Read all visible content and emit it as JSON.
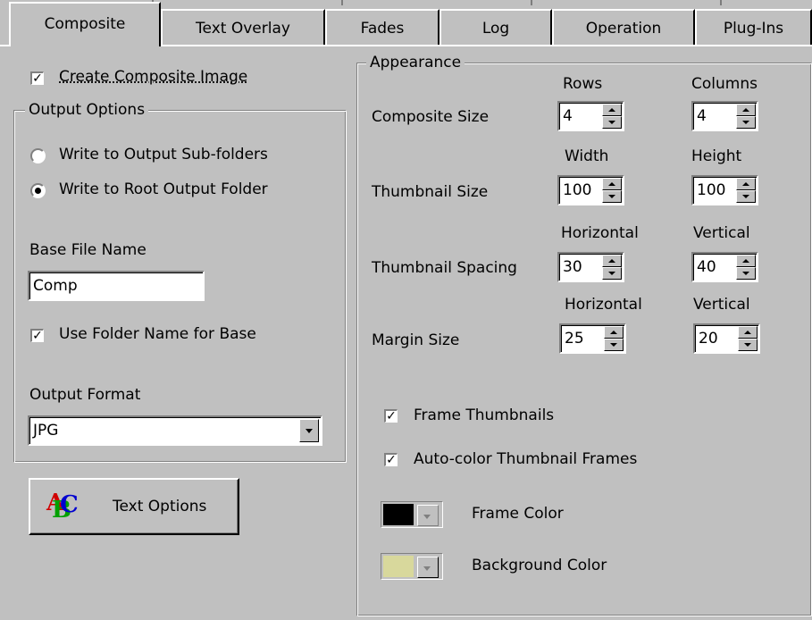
{
  "tabs": [
    "Composite",
    "Text Overlay",
    "Fades",
    "Log",
    "Operation",
    "Plug-Ins"
  ],
  "left": {
    "create_composite": {
      "label": "Create Composite Image",
      "checked": true
    },
    "output_options": {
      "title": "Output Options",
      "radio_subfolders": {
        "label": "Write to Output Sub-folders",
        "selected": false
      },
      "radio_root": {
        "label": "Write to Root Output Folder",
        "selected": true
      },
      "base_file_name": {
        "label": "Base File Name",
        "value": "Comp"
      },
      "use_folder_name": {
        "label": "Use Folder Name for Base",
        "checked": true
      },
      "output_format": {
        "label": "Output Format",
        "value": "JPG"
      }
    },
    "text_options_button": {
      "label": "Text Options",
      "icon": "abc-text-icon"
    }
  },
  "appearance": {
    "title": "Appearance",
    "composite_size": {
      "label": "Composite Size",
      "col1": "Rows",
      "col2": "Columns",
      "v1": "4",
      "v2": "4"
    },
    "thumbnail_size": {
      "label": "Thumbnail Size",
      "col1": "Width",
      "col2": "Height",
      "v1": "100",
      "v2": "100"
    },
    "thumbnail_spacing": {
      "label": "Thumbnail Spacing",
      "col1": "Horizontal",
      "col2": "Vertical",
      "v1": "30",
      "v2": "40"
    },
    "margin_size": {
      "label": "Margin Size",
      "col1": "Horizontal",
      "col2": "Vertical",
      "v1": "25",
      "v2": "20"
    },
    "frame_thumbnails": {
      "label": "Frame Thumbnails",
      "checked": true
    },
    "auto_color_frames": {
      "label": "Auto-color Thumbnail Frames",
      "checked": true
    },
    "frame_color": {
      "label": "Frame Color",
      "color": "#000000"
    },
    "background_color": {
      "label": "Background Color",
      "color": "#d8d89c"
    }
  }
}
